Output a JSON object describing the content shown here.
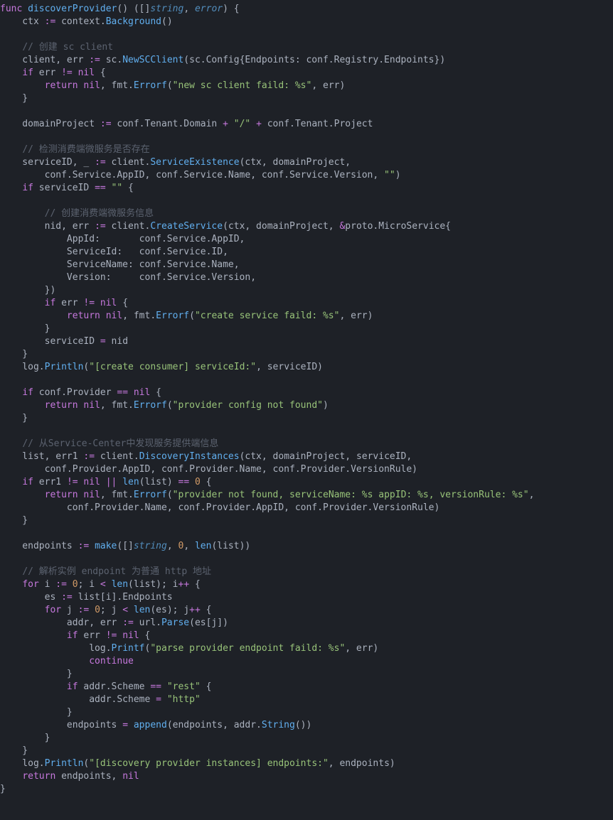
{
  "code": {
    "l1": "func discoverProvider() ([]string, error) {",
    "l2": "    ctx := context.Background()",
    "l3": "",
    "l4": "    // 创建 sc client",
    "l5": "    client, err := sc.NewSCClient(sc.Config{Endpoints: conf.Registry.Endpoints})",
    "l6": "    if err != nil {",
    "l7": "        return nil, fmt.Errorf(\"new sc client faild: %s\", err)",
    "l8": "    }",
    "l9": "",
    "l10": "    domainProject := conf.Tenant.Domain + \"/\" + conf.Tenant.Project",
    "l11": "",
    "l12": "    // 检测消费端微服务是否存在",
    "l13": "    serviceID, _ := client.ServiceExistence(ctx, domainProject,",
    "l14": "        conf.Service.AppID, conf.Service.Name, conf.Service.Version, \"\")",
    "l15": "    if serviceID == \"\" {",
    "l16": "",
    "l17": "        // 创建消费端微服务信息",
    "l18": "        nid, err := client.CreateService(ctx, domainProject, &proto.MicroService{",
    "l19": "            AppId:       conf.Service.AppID,",
    "l20": "            ServiceId:   conf.Service.ID,",
    "l21": "            ServiceName: conf.Service.Name,",
    "l22": "            Version:     conf.Service.Version,",
    "l23": "        })",
    "l24": "        if err != nil {",
    "l25": "            return nil, fmt.Errorf(\"create service faild: %s\", err)",
    "l26": "        }",
    "l27": "        serviceID = nid",
    "l28": "    }",
    "l29": "    log.Println(\"[create consumer] serviceId:\", serviceID)",
    "l30": "",
    "l31": "    if conf.Provider == nil {",
    "l32": "        return nil, fmt.Errorf(\"provider config not found\")",
    "l33": "    }",
    "l34": "",
    "l35": "    // 从Service-Center中发现服务提供端信息",
    "l36": "    list, err1 := client.DiscoveryInstances(ctx, domainProject, serviceID,",
    "l37": "        conf.Provider.AppID, conf.Provider.Name, conf.Provider.VersionRule)",
    "l38": "    if err1 != nil || len(list) == 0 {",
    "l39": "        return nil, fmt.Errorf(\"provider not found, serviceName: %s appID: %s, versionRule: %s\",",
    "l40": "            conf.Provider.Name, conf.Provider.AppID, conf.Provider.VersionRule)",
    "l41": "    }",
    "l42": "",
    "l43": "    endpoints := make([]string, 0, len(list))",
    "l44": "",
    "l45": "    // 解析实例 endpoint 为普通 http 地址",
    "l46": "    for i := 0; i < len(list); i++ {",
    "l47": "        es := list[i].Endpoints",
    "l48": "        for j := 0; j < len(es); j++ {",
    "l49": "            addr, err := url.Parse(es[j])",
    "l50": "            if err != nil {",
    "l51": "                log.Printf(\"parse provider endpoint faild: %s\", err)",
    "l52": "                continue",
    "l53": "            }",
    "l54": "            if addr.Scheme == \"rest\" {",
    "l55": "                addr.Scheme = \"http\"",
    "l56": "            }",
    "l57": "            endpoints = append(endpoints, addr.String())",
    "l58": "        }",
    "l59": "    }",
    "l60": "    log.Println(\"[discovery provider instances] endpoints:\", endpoints)",
    "l61": "    return endpoints, nil",
    "l62": "}"
  }
}
